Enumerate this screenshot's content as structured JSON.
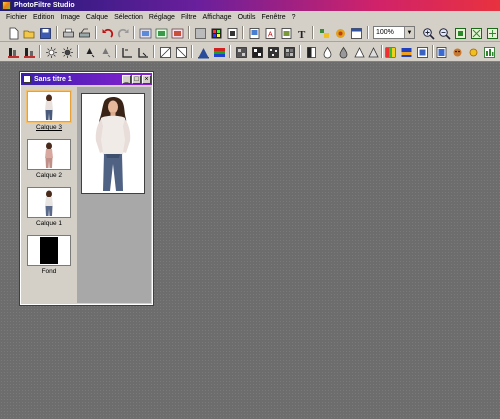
{
  "app": {
    "title": "PhotoFiltre Studio"
  },
  "menu": [
    "Fichier",
    "Edition",
    "Image",
    "Calque",
    "Sélection",
    "Réglage",
    "Filtre",
    "Affichage",
    "Outils",
    "Fenêtre",
    "?"
  ],
  "toolbar1": {
    "icons": [
      "new-icon",
      "open-icon",
      "save-icon",
      "print-icon",
      "scan-icon",
      "undo-icon",
      "redo-icon",
      "palette-icon",
      "image-size-icon",
      "canvas-size-icon",
      "color-icon",
      "transparency-icon",
      "copy-layer-icon",
      "paste-icon",
      "paste-layer-icon",
      "text-icon",
      "fill-icon",
      "brush-icon",
      "window-icon",
      "zoom-in-icon",
      "zoom-out-icon",
      "fit-icon",
      "actual-size-icon"
    ],
    "zoom_value": "100%"
  },
  "toolbar2": {
    "icons": [
      "auto-levels-icon",
      "auto-contrast-icon",
      "brightness-up-icon",
      "brightness-down-icon",
      "contrast-up-icon",
      "contrast-down-icon",
      "saturation-up-icon",
      "saturation-down-icon",
      "gamma-up-icon",
      "gamma-down-icon",
      "grayscale-icon",
      "sepia-icon",
      "rgb-icon",
      "levels-icon",
      "blur-icon",
      "sharpen-icon",
      "noise-icon",
      "drop-icon",
      "water-icon",
      "triangle-icon",
      "pencil-icon",
      "rainbow-icon",
      "flag-icon",
      "frame-icon",
      "image-icon",
      "dog-icon",
      "sun-icon",
      "bars-icon",
      "bars2-icon"
    ]
  },
  "document": {
    "title": "Sans titre 1",
    "buttons": {
      "minimize": "_",
      "maximize": "□",
      "close": "×"
    },
    "layers": [
      {
        "name": "Calque 3",
        "selected": true
      },
      {
        "name": "Calque 2",
        "selected": false
      },
      {
        "name": "Calque 1",
        "selected": false
      },
      {
        "name": "Fond",
        "selected": false
      }
    ]
  }
}
